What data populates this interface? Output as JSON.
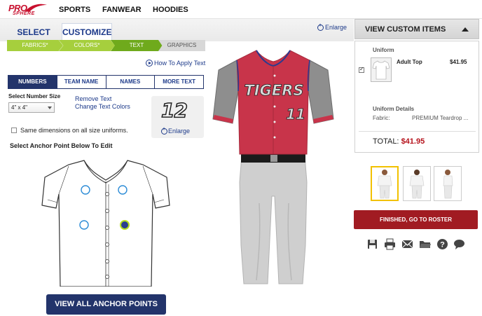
{
  "brand": {
    "logo_top": "PRO",
    "logo_bottom": "SPHERE",
    "accent": "#c8102e"
  },
  "nav": {
    "items": [
      "SPORTS",
      "FANWEAR",
      "HOODIES"
    ]
  },
  "tabs": {
    "select": "SELECT",
    "customize": "CUSTOMIZE"
  },
  "steps": [
    "FABRICS*",
    "COLORS*",
    "TEXT",
    "GRAPHICS"
  ],
  "howto": "How To Apply Text",
  "subtabs": [
    "NUMBERS",
    "TEAM NAME",
    "NAMES",
    "MORE TEXT"
  ],
  "number_size": {
    "label": "Select Number Size",
    "value": "4\" x 4\""
  },
  "links": {
    "remove": "Remove Text",
    "change_colors": "Change Text Colors"
  },
  "preview": {
    "number": "12",
    "enlarge": "Enlarge"
  },
  "same_dimensions": "Same dimensions on all size uniforms.",
  "anchor_title": "Select Anchor Point Below To Edit",
  "view_anchors_button": "VIEW ALL ANCHOR POINTS",
  "main_enlarge": "Enlarge",
  "uniform_preview": {
    "team_text": "TIGERS",
    "number": "11",
    "jersey_color": "#c8344a",
    "sleeve_color": "#8e8e8e",
    "pants_color": "#cfcfcf"
  },
  "panel": {
    "header": "VIEW CUSTOM ITEMS",
    "section": "Uniform",
    "item_name": "Adult Top",
    "item_price": "$41.95",
    "details_title": "Uniform Details",
    "fabric_label": "Fabric:",
    "fabric_value": "PREMIUM Teardrop ...",
    "total_label": "TOTAL:",
    "total_value": "$41.95"
  },
  "finish_button": "FINISHED, GO TO ROSTER",
  "action_icons": [
    "save-icon",
    "print-icon",
    "email-icon",
    "folder-icon",
    "help-icon",
    "chat-icon"
  ]
}
